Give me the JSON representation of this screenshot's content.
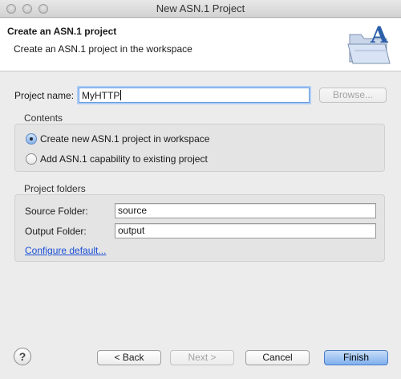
{
  "window": {
    "title": "New ASN.1 Project"
  },
  "banner": {
    "title": "Create an ASN.1 project",
    "description": "Create an ASN.1 project in the workspace"
  },
  "project": {
    "name_label": "Project name:",
    "name_value": "MyHTTP",
    "browse_label": "Browse..."
  },
  "contents": {
    "title": "Contents",
    "options": [
      {
        "label": "Create new ASN.1 project in workspace",
        "selected": true
      },
      {
        "label": "Add ASN.1 capability to existing project",
        "selected": false
      }
    ]
  },
  "folders": {
    "title": "Project folders",
    "source_label": "Source Folder:",
    "source_value": "source",
    "output_label": "Output Folder:",
    "output_value": "output",
    "configure_link": "Configure default..."
  },
  "footer": {
    "help_label": "?",
    "back_label": "< Back",
    "next_label": "Next >",
    "cancel_label": "Cancel",
    "finish_label": "Finish"
  },
  "colors": {
    "accent": "#4a7bc6",
    "link": "#1a4fd6",
    "banner_bg": "#ffffff",
    "window_bg": "#ececec"
  },
  "icons": {
    "banner": "folder-with-letter-a-icon",
    "help": "help-icon"
  }
}
